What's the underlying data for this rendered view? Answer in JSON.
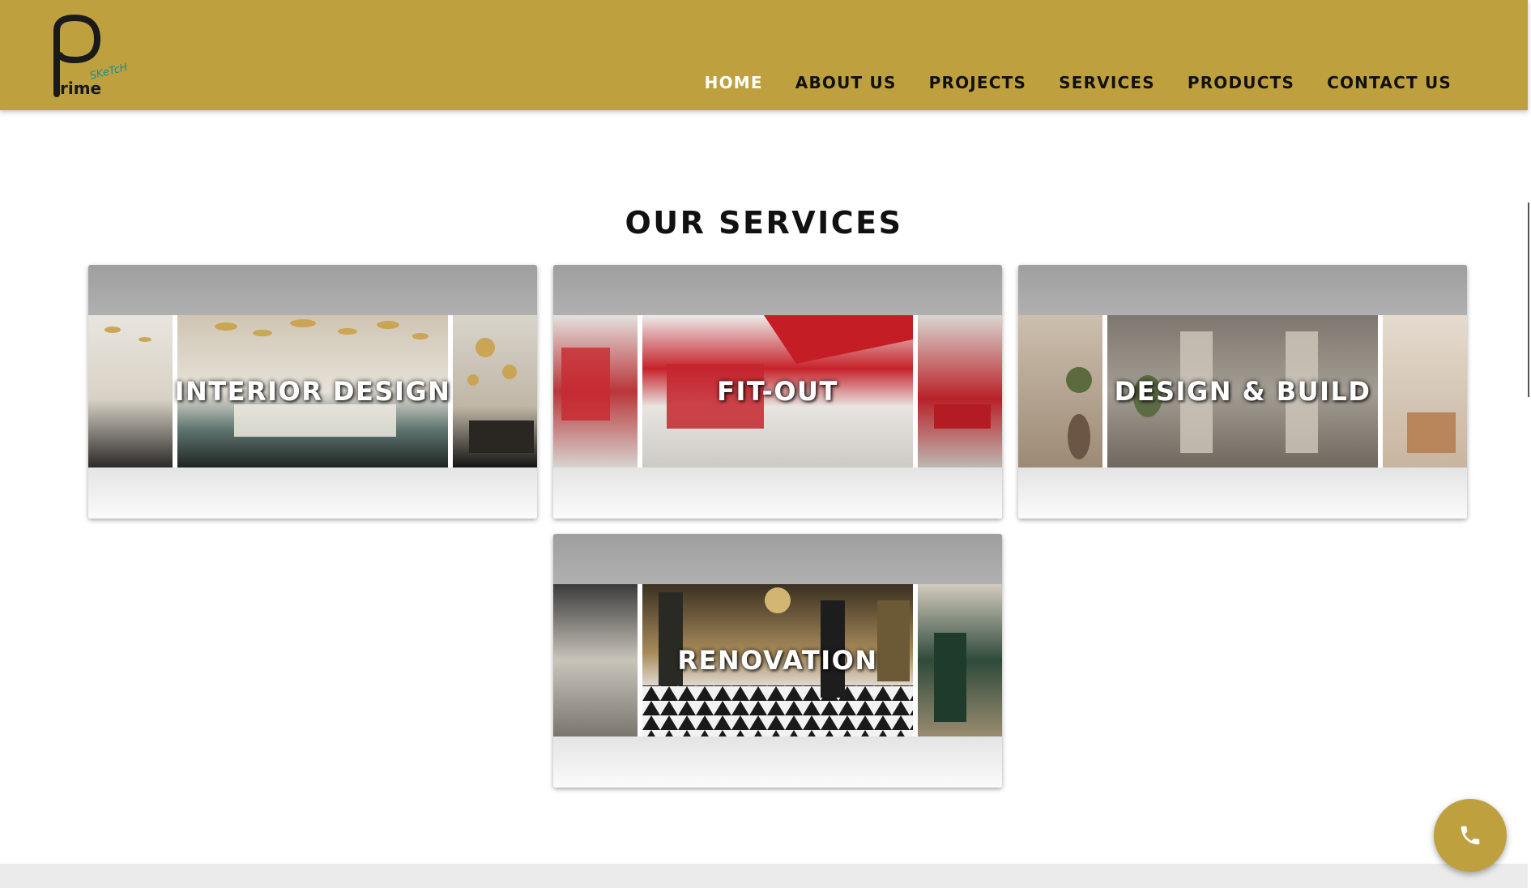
{
  "header": {
    "logo": {
      "letter": "P",
      "word": "rime",
      "script": "SKeTcH",
      "brand_color": "#bea13e",
      "script_color": "#1e8c8c"
    },
    "nav": [
      {
        "label": "HOME",
        "active": true
      },
      {
        "label": "ABOUT US",
        "active": false
      },
      {
        "label": "PROJECTS",
        "active": false
      },
      {
        "label": "SERVICES",
        "active": false
      },
      {
        "label": "PRODUCTS",
        "active": false
      },
      {
        "label": "CONTACT US",
        "active": false
      }
    ]
  },
  "main": {
    "title": "OUR SERVICES",
    "services": [
      {
        "title": "INTERIOR DESIGN",
        "image": "luxury-interior-lobby"
      },
      {
        "title": "FIT-OUT",
        "image": "ferrari-store-fitout"
      },
      {
        "title": "DESIGN & BUILD",
        "image": "minimal-cafe-interior"
      },
      {
        "title": "RENOVATION",
        "image": "marble-floor-boutique"
      }
    ]
  },
  "floating": {
    "phone_button_icon": "phone-icon"
  },
  "colors": {
    "accent": "#bea13e",
    "text": "#111111",
    "nav_active": "#ffffff"
  }
}
